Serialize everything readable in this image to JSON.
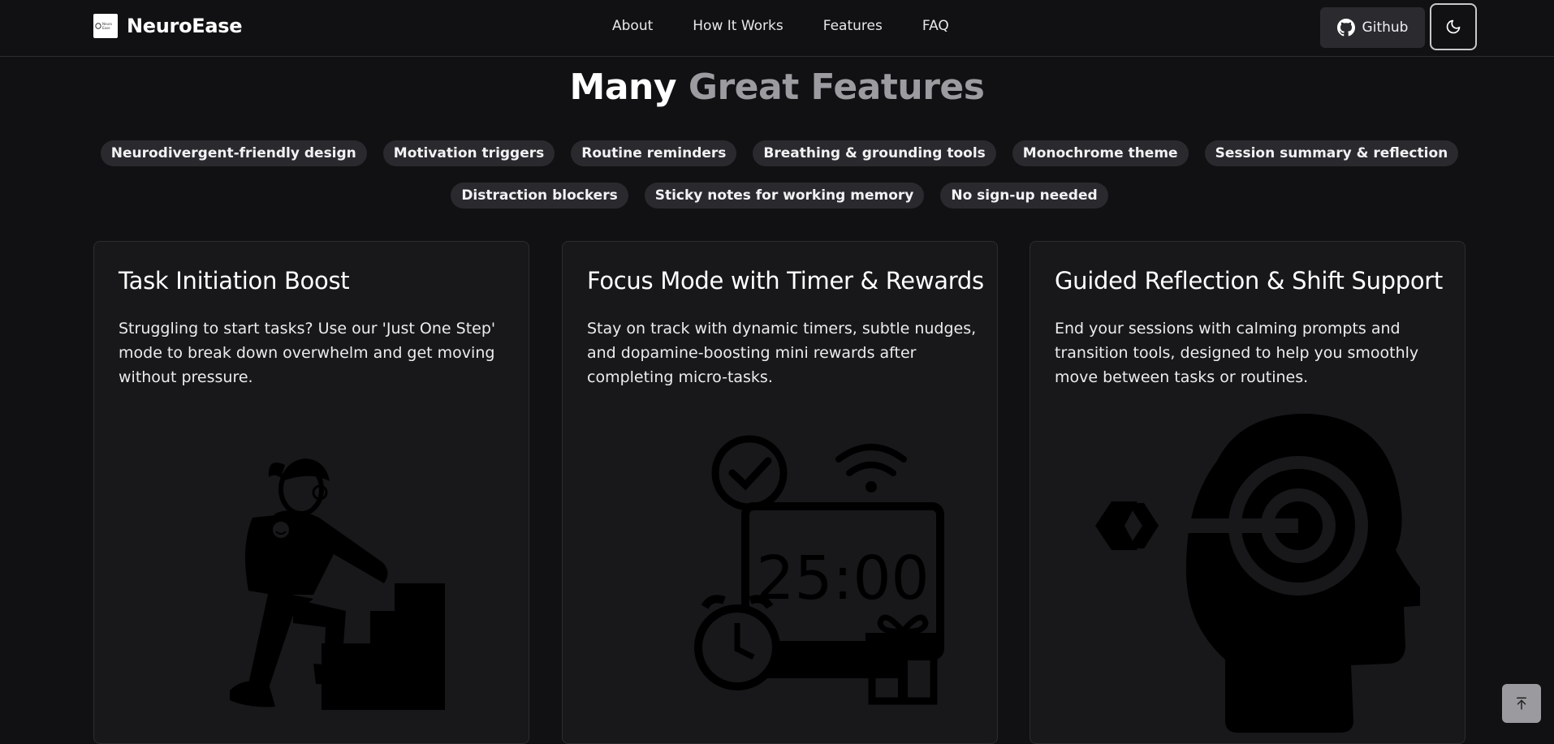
{
  "header": {
    "brand_name": "NeuroEase",
    "logo_text": "Neuro Ease",
    "nav": [
      {
        "label": "About"
      },
      {
        "label": "How It Works"
      },
      {
        "label": "Features"
      },
      {
        "label": "FAQ"
      }
    ],
    "github_label": "Github",
    "github_icon": "github-icon",
    "theme_icon": "moon-icon"
  },
  "features": {
    "title_part1": "Many",
    "title_part2": "Great Features",
    "tags": [
      "Neurodivergent-friendly design",
      "Motivation triggers",
      "Routine reminders",
      "Breathing & grounding tools",
      "Monochrome theme",
      "Session summary & reflection",
      "Distraction blockers",
      "Sticky notes for working memory",
      "No sign-up needed"
    ],
    "cards": [
      {
        "title": "Task Initiation Boost",
        "description": "Struggling to start tasks? Use our 'Just One Step' mode to break down overwhelm and get moving without pressure.",
        "illustration": "person-climbing-stairs-illustration"
      },
      {
        "title": "Focus Mode with Timer & Rewards",
        "description": "Stay on track with dynamic timers, subtle nudges, and dopamine-boosting mini rewards after completing micro-tasks.",
        "illustration": "timer-rewards-illustration",
        "timer_text": "25:00"
      },
      {
        "title": "Guided Reflection & Shift Support",
        "description": "End your sessions with calming prompts and transition tools, designed to help you smoothly move between tasks or routines.",
        "illustration": "head-target-illustration"
      }
    ]
  },
  "scroll_top_icon": "arrow-up-to-line-icon",
  "colors": {
    "background": "#111113",
    "card": "#18181b",
    "tag": "#2a2a2e",
    "muted_title": "#9b9ba0"
  }
}
